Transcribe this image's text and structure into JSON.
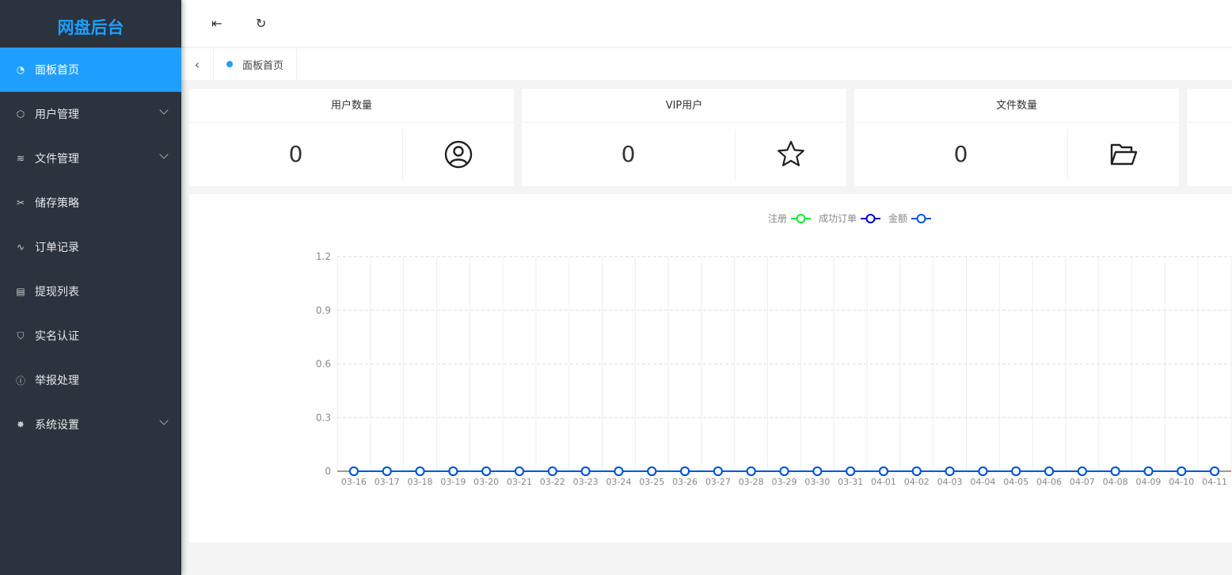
{
  "sidebar": {
    "logo": "网盘后台",
    "items": [
      {
        "label": "面板首页",
        "icon": "dashboard-icon",
        "active": true
      },
      {
        "label": "用户管理",
        "icon": "cube-icon",
        "expandable": true
      },
      {
        "label": "文件管理",
        "icon": "layers-icon",
        "expandable": true
      },
      {
        "label": "储存策略",
        "icon": "tools-icon"
      },
      {
        "label": "订单记录",
        "icon": "pulse-icon"
      },
      {
        "label": "提现列表",
        "icon": "clipboard-icon"
      },
      {
        "label": "实名认证",
        "icon": "shield-check-icon"
      },
      {
        "label": "举报处理",
        "icon": "info-icon"
      },
      {
        "label": "系统设置",
        "icon": "gear-icon",
        "expandable": true
      }
    ]
  },
  "header": {
    "menu_icon": "menu-fold-icon",
    "refresh_icon": "refresh-icon"
  },
  "tabs": [
    {
      "label": "面板首页"
    }
  ],
  "cards": [
    {
      "title": "用户数量",
      "value": "0",
      "icon": "user-circle-icon"
    },
    {
      "title": "VIP用户",
      "value": "0",
      "icon": "star-icon"
    },
    {
      "title": "文件数量",
      "value": "0",
      "icon": "folder-open-icon"
    },
    {
      "title": "",
      "value": "",
      "icon": ""
    }
  ],
  "colors": {
    "accent": "#1e9fff",
    "sidebar": "#2a333e"
  },
  "chart_data": {
    "type": "line",
    "categories": [
      "03-16",
      "03-17",
      "03-18",
      "03-19",
      "03-20",
      "03-21",
      "03-22",
      "03-23",
      "03-24",
      "03-25",
      "03-26",
      "03-27",
      "03-28",
      "03-29",
      "03-30",
      "03-31",
      "04-01",
      "04-02",
      "04-03",
      "04-04",
      "04-05",
      "04-06",
      "04-07",
      "04-08",
      "04-09",
      "04-10",
      "04-11"
    ],
    "series": [
      {
        "name": "注册",
        "color": "#00ee33",
        "values": [
          0,
          0,
          0,
          0,
          0,
          0,
          0,
          0,
          0,
          0,
          0,
          0,
          0,
          0,
          0,
          0,
          0,
          0,
          0,
          0,
          0,
          0,
          0,
          0,
          0,
          0,
          0
        ]
      },
      {
        "name": "成功订单",
        "color": "#0000cc",
        "values": [
          0,
          0,
          0,
          0,
          0,
          0,
          0,
          0,
          0,
          0,
          0,
          0,
          0,
          0,
          0,
          0,
          0,
          0,
          0,
          0,
          0,
          0,
          0,
          0,
          0,
          0,
          0
        ]
      },
      {
        "name": "金额",
        "color": "#0055dd",
        "values": [
          0,
          0,
          0,
          0,
          0,
          0,
          0,
          0,
          0,
          0,
          0,
          0,
          0,
          0,
          0,
          0,
          0,
          0,
          0,
          0,
          0,
          0,
          0,
          0,
          0,
          0,
          0
        ]
      }
    ],
    "yticks": [
      "0",
      "0.3",
      "0.6",
      "0.9",
      "1.2"
    ],
    "ylim": [
      0,
      1.2
    ],
    "grid": true,
    "legend": "top-center"
  }
}
